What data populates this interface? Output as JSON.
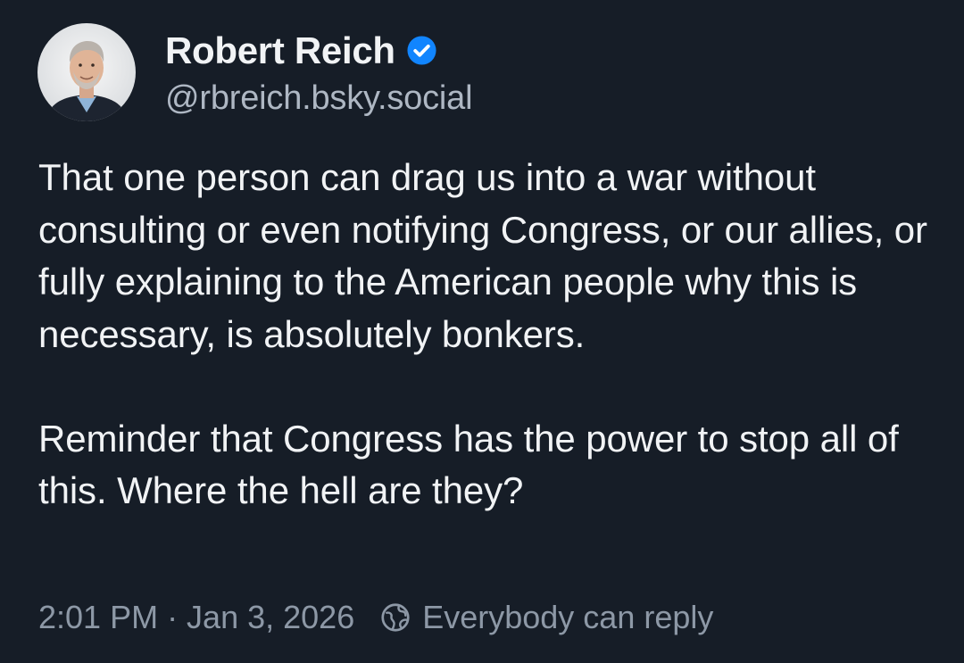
{
  "author": {
    "display_name": "Robert Reich",
    "handle": "@rbreich.bsky.social",
    "verified": true,
    "avatar_icon": "profile-photo"
  },
  "post": {
    "text": "That one person can drag us into a war without consulting or even notifying Congress, or our allies, or fully explaining to the American people why this is necessary, is absolutely bonkers.\n\nReminder that Congress has the power to stop all of this. Where the hell are they?"
  },
  "meta": {
    "timestamp": "2:01 PM · Jan 3, 2026",
    "reply_setting": "Everybody can reply",
    "reply_icon": "globe-icon"
  },
  "colors": {
    "background": "#161d27",
    "text_primary": "#f1f3f5",
    "text_secondary": "#aeb7c3",
    "meta_text": "#8d98a6",
    "verified_badge": "#1185fe"
  }
}
